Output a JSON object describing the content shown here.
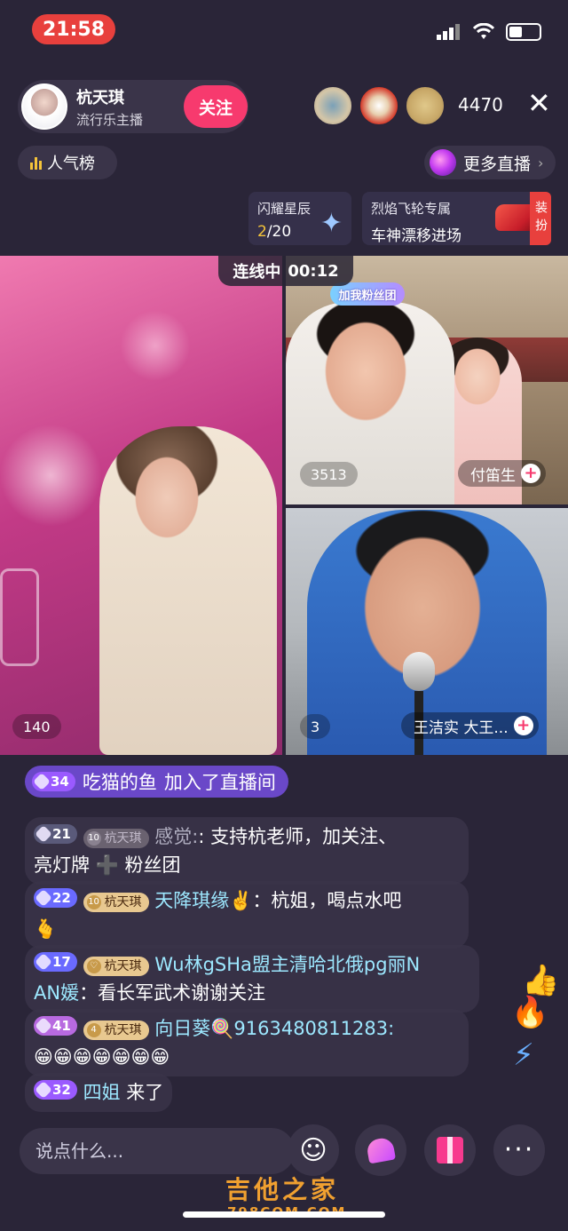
{
  "status": {
    "time": "21:58"
  },
  "host": {
    "name": "杭天琪",
    "subtitle": "流行乐主播",
    "follow_label": "关注"
  },
  "viewers": {
    "count": "4470"
  },
  "rank": {
    "label": "人气榜"
  },
  "more_live": {
    "label": "更多直播"
  },
  "activity": {
    "star": {
      "title": "闪耀星辰",
      "progress_current": "2",
      "progress_total": "/20"
    },
    "car": {
      "title": "烈焰飞轮专属",
      "subtitle": "车神漂移进场"
    },
    "dress_tag": "装扮"
  },
  "link": {
    "label": "连线中",
    "timer": "00:12"
  },
  "videos": {
    "left": {
      "count": "140"
    },
    "right_top": {
      "count": "3513",
      "name": "付笛生",
      "badge": "加我粉丝团"
    },
    "right_bottom": {
      "count": "3",
      "name": "王洁实 大王..."
    }
  },
  "chat": {
    "join": {
      "level": "34",
      "user": "吃猫的鱼",
      "text": "加入了直播间"
    },
    "messages": [
      {
        "level": "21",
        "fan_level": "10",
        "fan_name": "杭天琪",
        "user": "感觉:",
        "text_line1": ": 支持杭老师，加关注、",
        "text_line2": "亮灯牌 ➕ 粉丝团"
      },
      {
        "level": "22",
        "fan_level": "10",
        "fan_name": "杭天琪",
        "user": "天降琪缘✌️",
        "text_line1": "：杭姐，喝点水吧",
        "text_line2": "🫰"
      },
      {
        "level": "17",
        "fan_level": "♡",
        "fan_name": "杭天琪",
        "user": "Wu林gSHa盟主清哈北俄pg丽N",
        "text_line1": "",
        "text_line2": "AN媛：看长军武术谢谢关注",
        "user_line2": "AN媛",
        "text_line2_rest": "：看长军武术谢谢关注"
      },
      {
        "level": "41",
        "fan_level": "4",
        "fan_name": "杭天琪",
        "user": "向日葵🍭9163480811283:",
        "text_line1": "",
        "text_line2": "😁😁😁😁😁😁😁"
      },
      {
        "level": "32",
        "user": "四姐",
        "text": "来了"
      }
    ]
  },
  "input": {
    "placeholder": "说点什么..."
  },
  "watermark": {
    "line1": "吉他之家",
    "line2": "798COM.COM"
  }
}
